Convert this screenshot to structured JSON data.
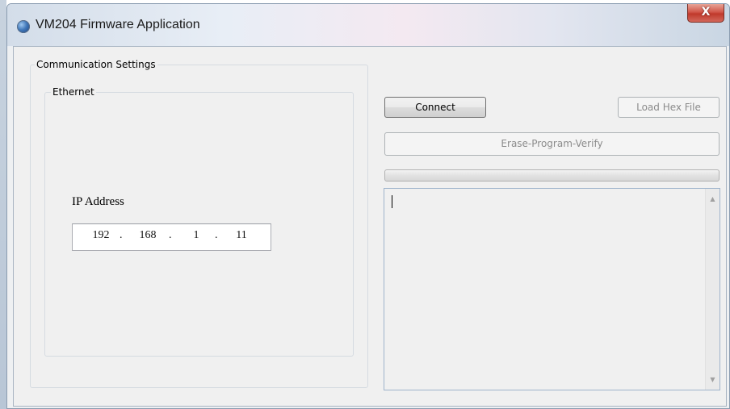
{
  "window": {
    "title": "VM204 Firmware Application",
    "close_glyph": "X",
    "icon": "globe-app-icon"
  },
  "communication": {
    "group_label": "Communication Settings",
    "ethernet": {
      "group_label": "Ethernet",
      "ip_label": "IP Address",
      "ip_octets": [
        "192",
        "168",
        "1",
        "11"
      ],
      "ip_separator": "."
    }
  },
  "actions": {
    "connect_label": "Connect",
    "load_hex_label": "Load Hex File",
    "erase_program_verify_label": "Erase-Program-Verify"
  },
  "progress": {
    "value": 0
  },
  "log": {
    "text": "",
    "scroll_up_glyph": "▲",
    "scroll_down_glyph": "▼"
  }
}
